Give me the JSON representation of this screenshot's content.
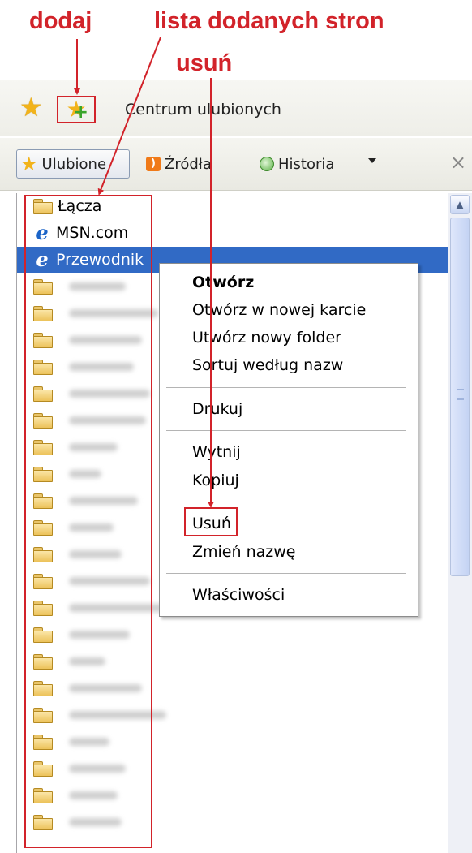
{
  "annotations": {
    "add": "dodaj",
    "list": "lista dodanych stron",
    "delete": "usuń"
  },
  "colors": {
    "annotation": "#d2232a",
    "selection": "#316ac5",
    "star": "#f2b31a"
  },
  "titlebar": {
    "title": "Centrum ulubionych",
    "favorites_icon": "star-icon",
    "add_icon": "add-favorite-icon"
  },
  "toolbar": {
    "tabs": [
      {
        "label": "Ulubione",
        "icon": "star-icon"
      },
      {
        "label": "Źródła",
        "icon": "rss-icon"
      },
      {
        "label": "Historia",
        "icon": "history-icon"
      }
    ],
    "close_label": "×"
  },
  "list": {
    "items": [
      {
        "label": "Łącza",
        "icon": "folder-icon"
      },
      {
        "label": "MSN.com",
        "icon": "ie-icon"
      },
      {
        "label": "Przewodnik",
        "icon": "ie-icon",
        "selected": true
      }
    ]
  },
  "context_menu": {
    "items": [
      {
        "label": "Otwórz",
        "bold": true
      },
      {
        "label": "Otwórz w nowej karcie"
      },
      {
        "label": "Utwórz nowy folder"
      },
      {
        "label": "Sortuj według nazw"
      },
      {
        "label": "Drukuj"
      },
      {
        "label": "Wytnij"
      },
      {
        "label": "Kopiuj"
      },
      {
        "label": "Usuń"
      },
      {
        "label": "Zmień nazwę"
      },
      {
        "label": "Właściwości"
      }
    ]
  }
}
